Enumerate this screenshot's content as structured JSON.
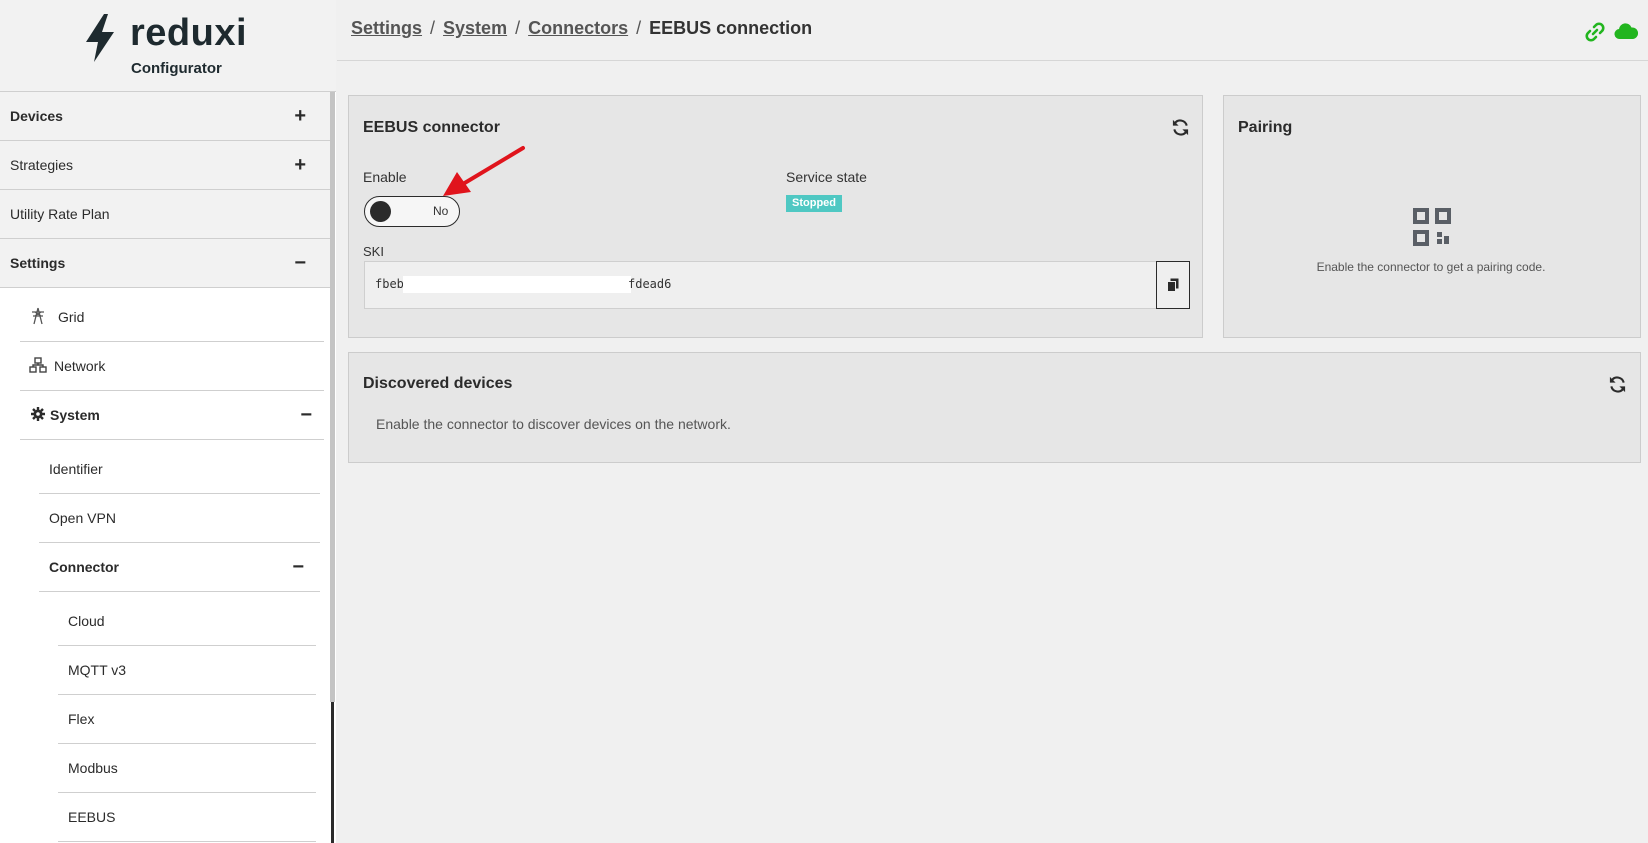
{
  "app": {
    "logo_text": "reduxi",
    "logo_subtitle": "Configurator"
  },
  "sidebar": {
    "top_items": [
      {
        "label": "Devices",
        "state": "+"
      },
      {
        "label": "Strategies",
        "state": "+"
      },
      {
        "label": "Utility Rate Plan",
        "state": ""
      },
      {
        "label": "Settings",
        "state": "−"
      }
    ],
    "settings_items": [
      {
        "label": "Grid"
      },
      {
        "label": "Network"
      },
      {
        "label": "System",
        "state": "−"
      }
    ],
    "system_items": [
      {
        "label": "Identifier"
      },
      {
        "label": "Open VPN"
      },
      {
        "label": "Connector",
        "state": "−"
      }
    ],
    "connector_items": [
      {
        "label": "Cloud"
      },
      {
        "label": "MQTT v3"
      },
      {
        "label": "Flex"
      },
      {
        "label": "Modbus"
      },
      {
        "label": "EEBUS"
      }
    ]
  },
  "breadcrumb": {
    "items": [
      "Settings",
      "System",
      "Connectors"
    ],
    "current": "EEBUS connection",
    "separator": "/"
  },
  "eebus_card": {
    "title": "EEBUS connector",
    "enable_label": "Enable",
    "toggle_value": "No",
    "service_state_label": "Service state",
    "service_state": "Stopped",
    "ski_label": "SKI",
    "ski_prefix": "fbeb",
    "ski_suffix": "fdead6"
  },
  "pairing_card": {
    "title": "Pairing",
    "message": "Enable the connector to get a pairing code."
  },
  "discovered_card": {
    "title": "Discovered devices",
    "message": "Enable the connector to discover devices on the network."
  },
  "icons": [
    "lightning-bolt-icon",
    "plus-icon",
    "minus-icon",
    "transmission-tower-icon",
    "network-icon",
    "gear-icon",
    "link-icon",
    "cloud-icon",
    "refresh-icon",
    "copy-icon",
    "qr-code-icon",
    "red-arrow-annotation"
  ],
  "colors": {
    "badge": "#4fc8c3",
    "status_green": "#22b51f",
    "annotation_red": "#e0141c"
  }
}
